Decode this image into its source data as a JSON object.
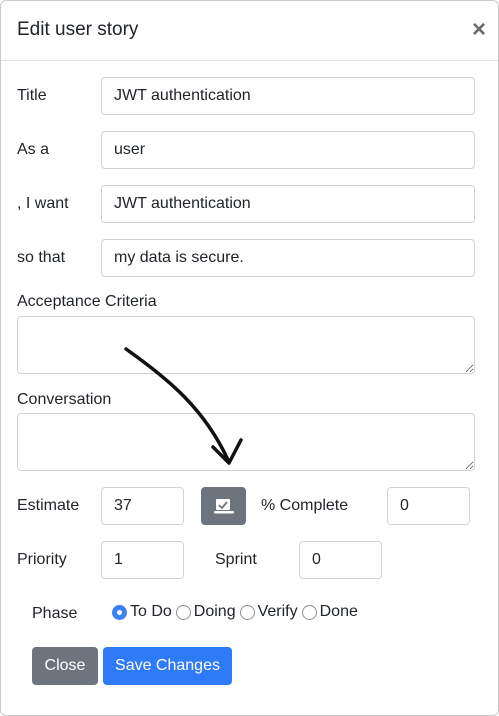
{
  "modal": {
    "title": "Edit user story",
    "close_symbol": "×"
  },
  "fields": {
    "title": {
      "label": "Title",
      "value": "JWT authentication"
    },
    "as_a": {
      "label": "As a",
      "value": "user"
    },
    "i_want": {
      "label": ", I want",
      "value": "JWT authentication"
    },
    "so_that": {
      "label": "so that",
      "value": "my data is secure."
    },
    "acceptance": {
      "label": "Acceptance Criteria",
      "value": ""
    },
    "conversation": {
      "label": "Conversation",
      "value": ""
    },
    "estimate": {
      "label": "Estimate",
      "value": "37"
    },
    "complete": {
      "label": "% Complete",
      "value": "0"
    },
    "priority": {
      "label": "Priority",
      "value": "1"
    },
    "sprint": {
      "label": "Sprint",
      "value": "0"
    }
  },
  "estimate_button": {
    "icon": "calculator-check-icon"
  },
  "phase": {
    "label": "Phase",
    "options": [
      "To Do",
      "Doing",
      "Verify",
      "Done"
    ],
    "selected": "To Do"
  },
  "buttons": {
    "close_label": "Close",
    "save_label": "Save Changes"
  },
  "colors": {
    "secondary": "#6c757d",
    "primary": "#2f7af7",
    "radio_checked": "#3b82f6",
    "border": "#ced4da"
  }
}
